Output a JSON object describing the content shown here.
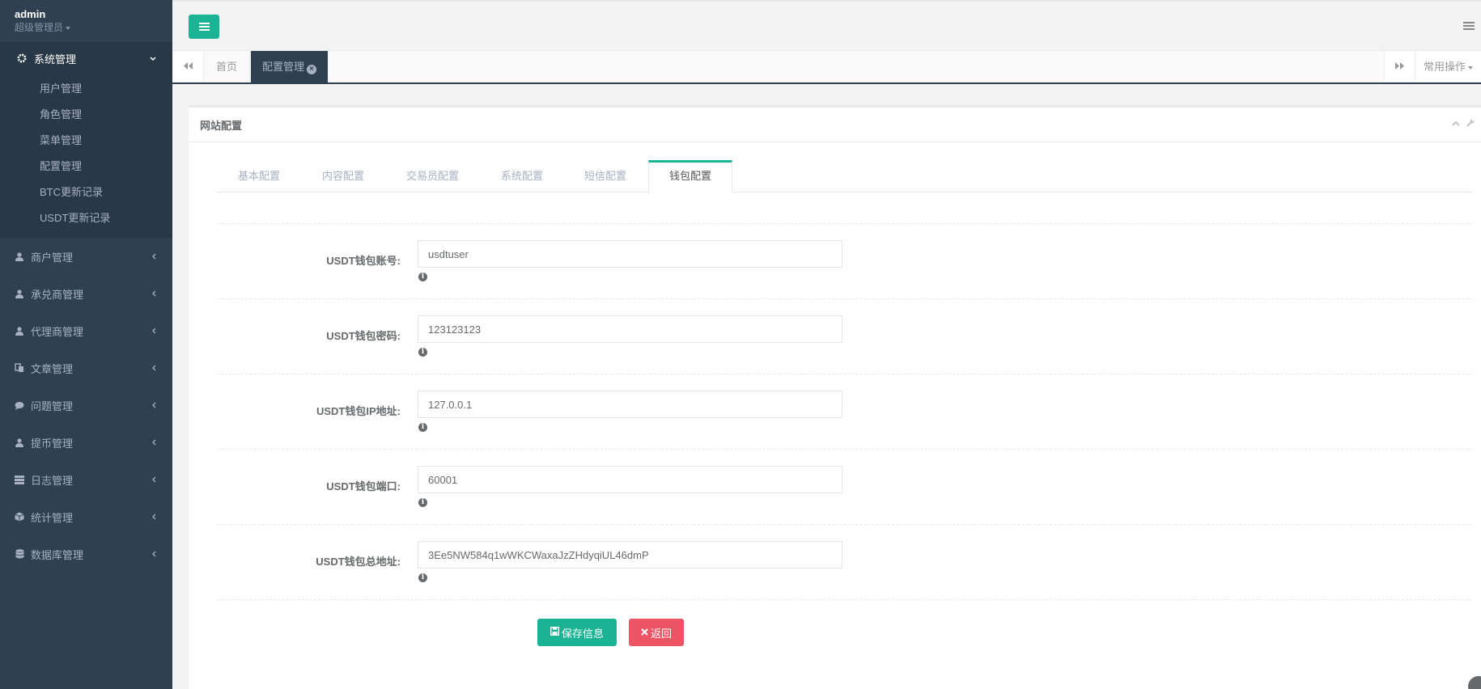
{
  "profile": {
    "name": "admin",
    "role": "超级管理员"
  },
  "sidebar": {
    "active_group": {
      "label": "系统管理",
      "icon": "gear-icon"
    },
    "subitems": [
      {
        "label": "用户管理"
      },
      {
        "label": "角色管理"
      },
      {
        "label": "菜单管理"
      },
      {
        "label": "配置管理"
      },
      {
        "label": "BTC更新记录"
      },
      {
        "label": "USDT更新记录"
      }
    ],
    "items": [
      {
        "label": "商户管理",
        "icon": "user-icon"
      },
      {
        "label": "承兑商管理",
        "icon": "user-icon"
      },
      {
        "label": "代理商管理",
        "icon": "user-icon"
      },
      {
        "label": "文章管理",
        "icon": "copy-icon"
      },
      {
        "label": "问题管理",
        "icon": "comment-icon"
      },
      {
        "label": "提币管理",
        "icon": "user-icon"
      },
      {
        "label": "日志管理",
        "icon": "server-icon"
      },
      {
        "label": "统计管理",
        "icon": "cube-icon"
      },
      {
        "label": "数据库管理",
        "icon": "database-icon"
      }
    ]
  },
  "tabstrip": {
    "home": "首页",
    "active": "配置管理",
    "ops": "常用操作"
  },
  "panel": {
    "title": "网站配置",
    "tabs": [
      {
        "label": "基本配置"
      },
      {
        "label": "内容配置"
      },
      {
        "label": "交易员配置"
      },
      {
        "label": "系统配置"
      },
      {
        "label": "短信配置"
      },
      {
        "label": "钱包配置"
      }
    ],
    "active_tab": "钱包配置",
    "fields": [
      {
        "label": "USDT钱包账号:",
        "value": "usdtuser"
      },
      {
        "label": "USDT钱包密码:",
        "value": "123123123"
      },
      {
        "label": "USDT钱包IP地址:",
        "value": "127.0.0.1"
      },
      {
        "label": "USDT钱包端口:",
        "value": "60001"
      },
      {
        "label": "USDT钱包总地址:",
        "value": "3Ee5NW584q1wWKCWaxaJzZHdyqiUL46dmP"
      }
    ],
    "save_label": "保存信息",
    "back_label": "返回"
  },
  "colors": {
    "primary": "#1ab394",
    "danger": "#ed5565",
    "sidebar": "#2f4050"
  }
}
